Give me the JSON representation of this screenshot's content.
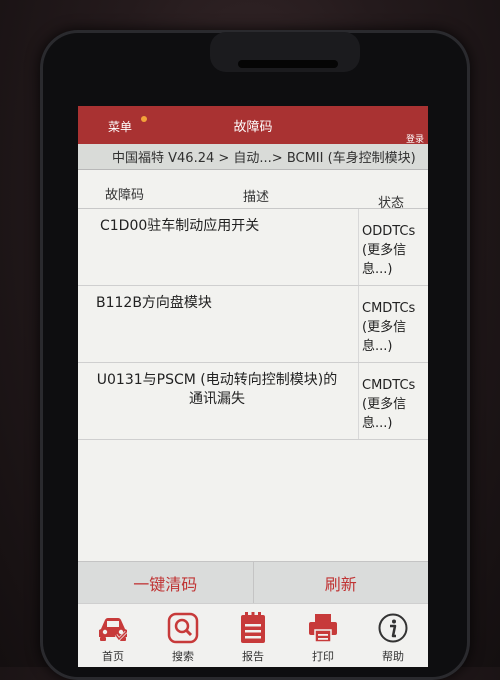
{
  "header": {
    "menu_label": "菜单",
    "title": "故障码",
    "login_label": "登录"
  },
  "breadcrumb": "中国福特 V46.24 > 自动...> BCMII (车身控制模块)",
  "table": {
    "headers": {
      "code": "故障码",
      "description": "描述",
      "status": "状态"
    },
    "rows": [
      {
        "description": "C1D00驻车制动应用开关",
        "status_line1": "ODDTCs",
        "status_line2": "(更多信",
        "status_line3": "息...)"
      },
      {
        "description": "B112B方向盘模块",
        "status_line1": "CMDTCs",
        "status_line2": "(更多信",
        "status_line3": "息...)"
      },
      {
        "description": "U0131与PSCM (电动转向控制模块)的通讯漏失",
        "status_line1": "CMDTCs",
        "status_line2": "(更多信",
        "status_line3": "息...)"
      }
    ]
  },
  "actions": {
    "clear_codes": "一键清码",
    "refresh": "刷新"
  },
  "tabs": [
    {
      "label": "首页",
      "icon": "car-icon"
    },
    {
      "label": "搜索",
      "icon": "search-icon"
    },
    {
      "label": "报告",
      "icon": "report-icon"
    },
    {
      "label": "打印",
      "icon": "printer-icon"
    },
    {
      "label": "帮助",
      "icon": "info-icon"
    }
  ],
  "colors": {
    "header_red": "#a93232",
    "accent_red": "#c03434",
    "notification_dot": "#f3a23a"
  }
}
